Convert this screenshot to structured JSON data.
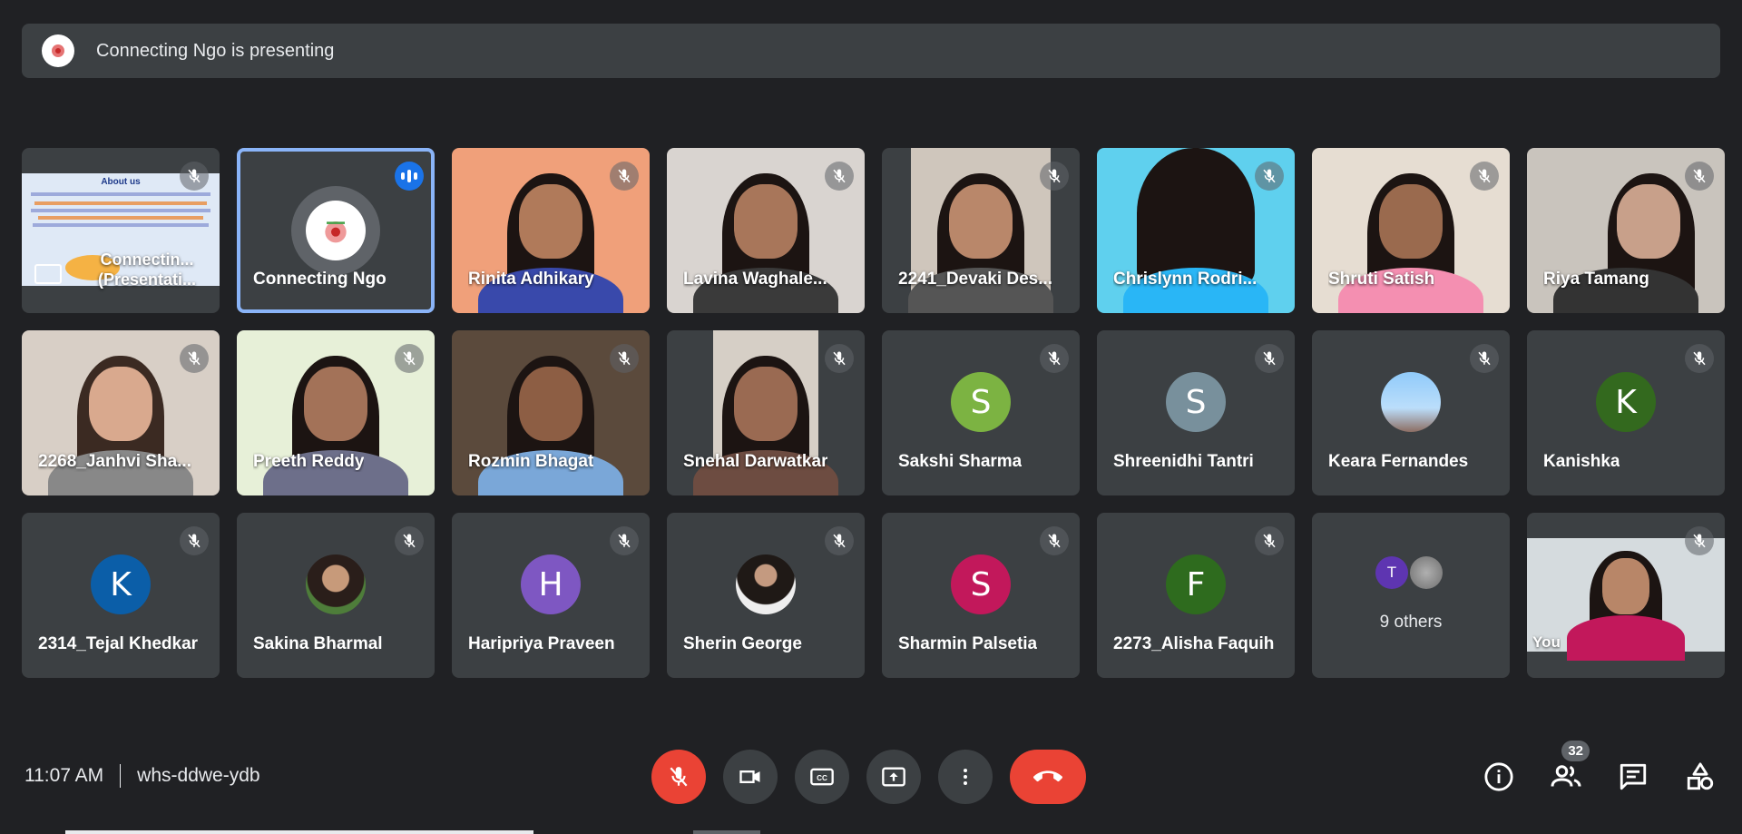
{
  "banner": {
    "text": "Connecting Ngo is presenting"
  },
  "presentation": {
    "slide_title": "About us",
    "name_line1": "Connectin...",
    "name_line2": "(Presentati..."
  },
  "tiles": [
    {
      "name": "Connecting Ngo"
    },
    {
      "name": "Rinita Adhikary"
    },
    {
      "name": "Lavina Waghale..."
    },
    {
      "name": "2241_Devaki Des..."
    },
    {
      "name": "Chrislynn Rodri..."
    },
    {
      "name": "Shruti Satish"
    },
    {
      "name": "Riya Tamang"
    },
    {
      "name": "2268_Janhvi Sha..."
    },
    {
      "name": "Preeth Reddy"
    },
    {
      "name": "Rozmin Bhagat"
    },
    {
      "name": "Snehal Darwatkar"
    },
    {
      "name": "Sakshi Sharma",
      "initial": "S",
      "color": "#7cb342"
    },
    {
      "name": "Shreenidhi Tantri",
      "initial": "S",
      "color": "#78909c"
    },
    {
      "name": "Keara Fernandes"
    },
    {
      "name": "Kanishka",
      "initial": "K",
      "color": "#33691e"
    },
    {
      "name": "2314_Tejal Khedkar",
      "initial": "K",
      "color": "#0b5ea8"
    },
    {
      "name": "Sakina Bharmal"
    },
    {
      "name": "Haripriya Praveen",
      "initial": "H",
      "color": "#7e57c2"
    },
    {
      "name": "Sherin George"
    },
    {
      "name": "Sharmin Palsetia",
      "initial": "S",
      "color": "#c2185b"
    },
    {
      "name": "2273_Alisha Faquih",
      "initial": "F",
      "color": "#2e6b1e"
    },
    {
      "name": "You"
    }
  ],
  "others": {
    "label": "9 others",
    "initial": "T",
    "color": "#5e35b1"
  },
  "meeting": {
    "time": "11:07 AM",
    "code": "whs-ddwe-ydb"
  },
  "participants_count": "32",
  "controls": [
    "mic-off-icon",
    "camera-icon",
    "captions-icon",
    "present-icon",
    "more-icon",
    "hang-up-icon"
  ],
  "right_controls": [
    "info-icon",
    "people-icon",
    "chat-icon",
    "activities-icon"
  ]
}
